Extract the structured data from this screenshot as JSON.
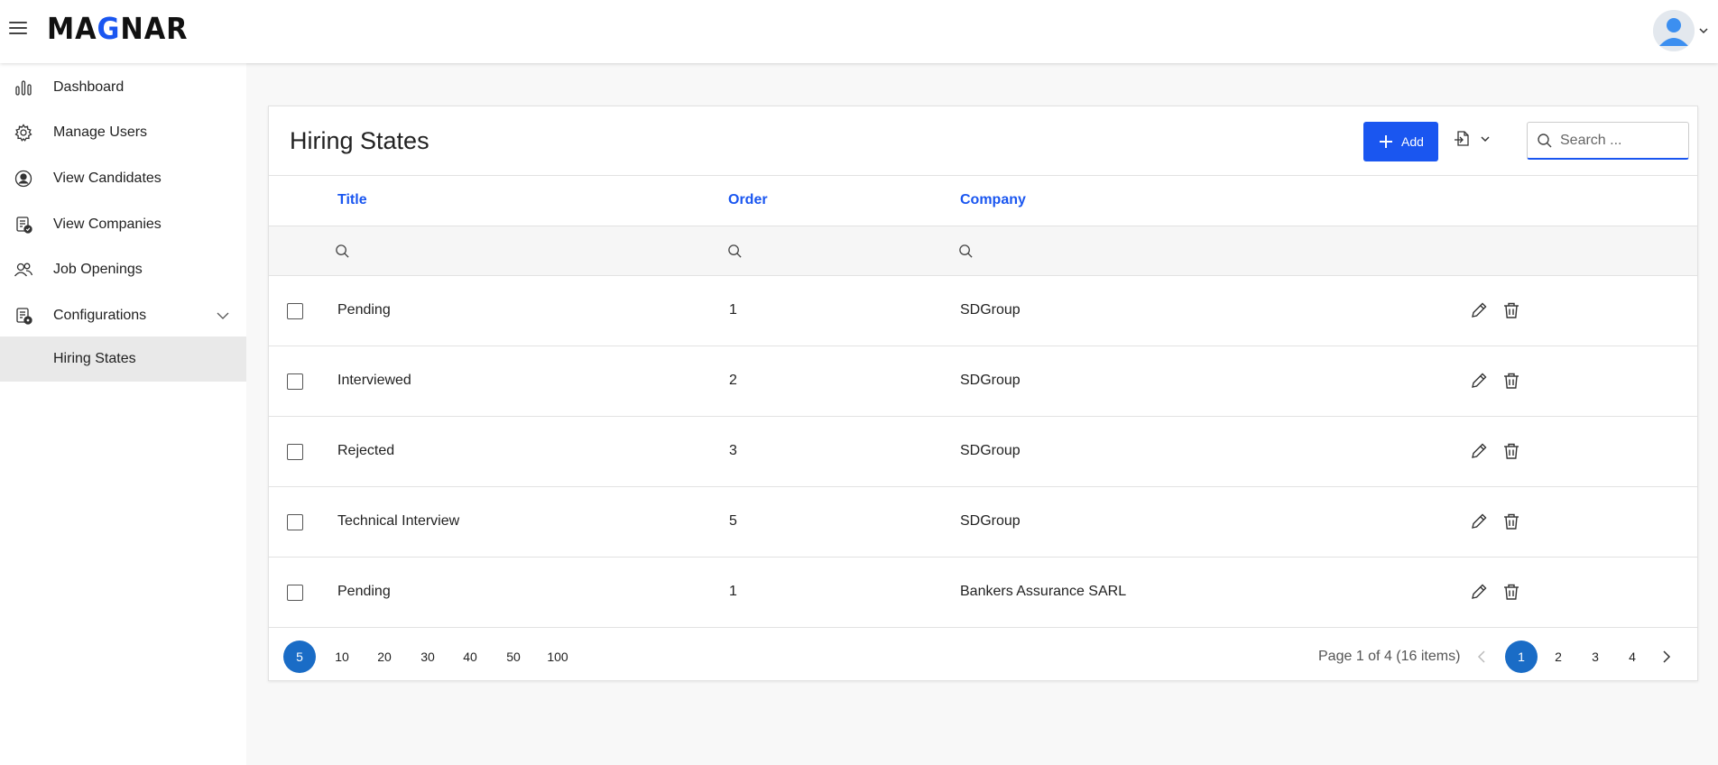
{
  "brand": {
    "logo_prefix": "MA",
    "logo_accent": "G",
    "logo_suffix": "NAR",
    "accent_color": "#1a56f0"
  },
  "sidebar": {
    "items": [
      {
        "label": "Dashboard",
        "icon": "bar-chart-icon"
      },
      {
        "label": "Manage Users",
        "icon": "gear-icon"
      },
      {
        "label": "View Candidates",
        "icon": "user-circle-icon"
      },
      {
        "label": "View Companies",
        "icon": "clipboard-check-icon"
      },
      {
        "label": "Job Openings",
        "icon": "users-icon"
      },
      {
        "label": "Configurations",
        "icon": "clipboard-settings-icon",
        "expanded": true
      }
    ],
    "sub_items": [
      {
        "label": "Hiring States",
        "selected": true
      }
    ]
  },
  "main": {
    "title": "Hiring States",
    "add_label": "Add",
    "search_placeholder": "Search ...",
    "columns": [
      "Title",
      "Order",
      "Company"
    ],
    "rows": [
      {
        "title": "Pending",
        "order": "1",
        "company": "SDGroup"
      },
      {
        "title": "Interviewed",
        "order": "2",
        "company": "SDGroup"
      },
      {
        "title": "Rejected",
        "order": "3",
        "company": "SDGroup"
      },
      {
        "title": "Technical Interview",
        "order": "5",
        "company": "SDGroup"
      },
      {
        "title": "Pending",
        "order": "1",
        "company": "Bankers Assurance SARL"
      }
    ]
  },
  "pager": {
    "sizes": [
      "5",
      "10",
      "20",
      "30",
      "40",
      "50",
      "100"
    ],
    "selected_size": "5",
    "info": "Page 1 of 4 (16 items)",
    "pages": [
      "1",
      "2",
      "3",
      "4"
    ],
    "current_page": "1"
  }
}
